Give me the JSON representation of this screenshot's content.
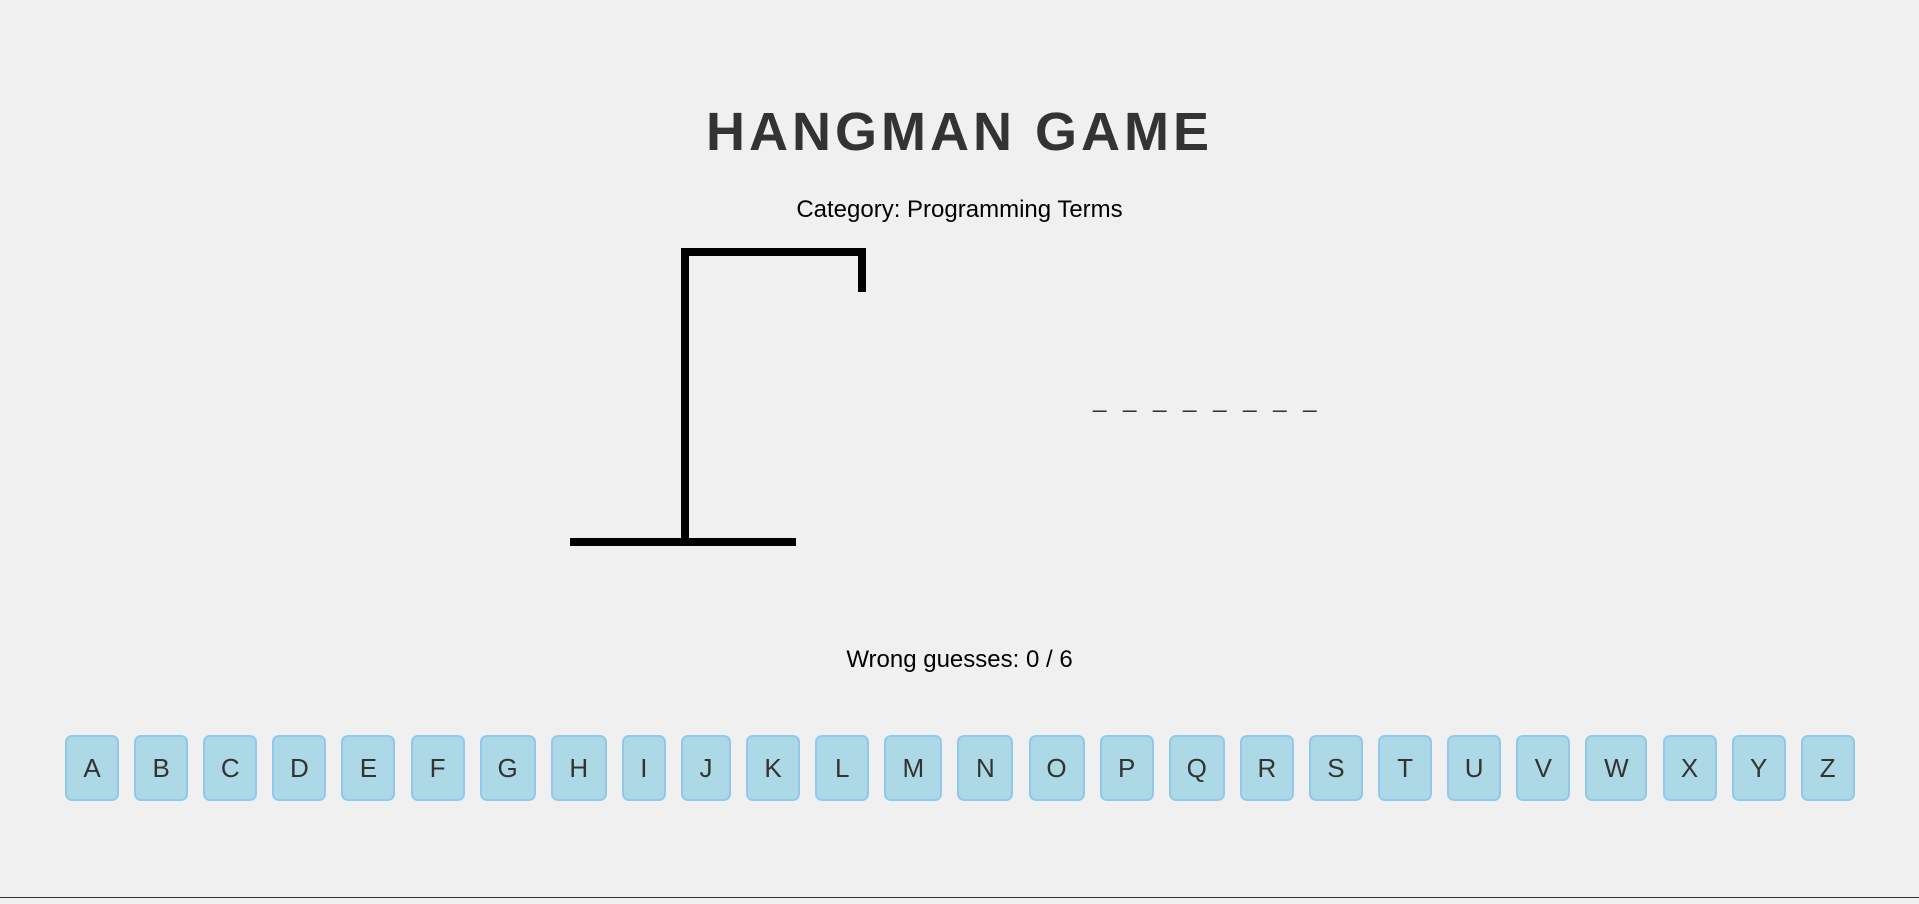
{
  "game": {
    "title": "HANGMAN GAME",
    "category_label": "Category: Programming Terms",
    "masked_word": "_ _ _ _ _ _ _ _",
    "wrong_guesses_label": "Wrong guesses:",
    "wrong_guesses": "0 / 6"
  },
  "keyboard": {
    "keys": [
      "A",
      "B",
      "C",
      "D",
      "E",
      "F",
      "G",
      "H",
      "I",
      "J",
      "K",
      "L",
      "M",
      "N",
      "O",
      "P",
      "Q",
      "R",
      "S",
      "T",
      "U",
      "V",
      "W",
      "X",
      "Y",
      "Z"
    ]
  },
  "colors": {
    "background": "#f0f0f0",
    "key_fill": "#add8e6",
    "key_border": "#90c8f0",
    "gallows": "#000000",
    "title": "#333333"
  }
}
